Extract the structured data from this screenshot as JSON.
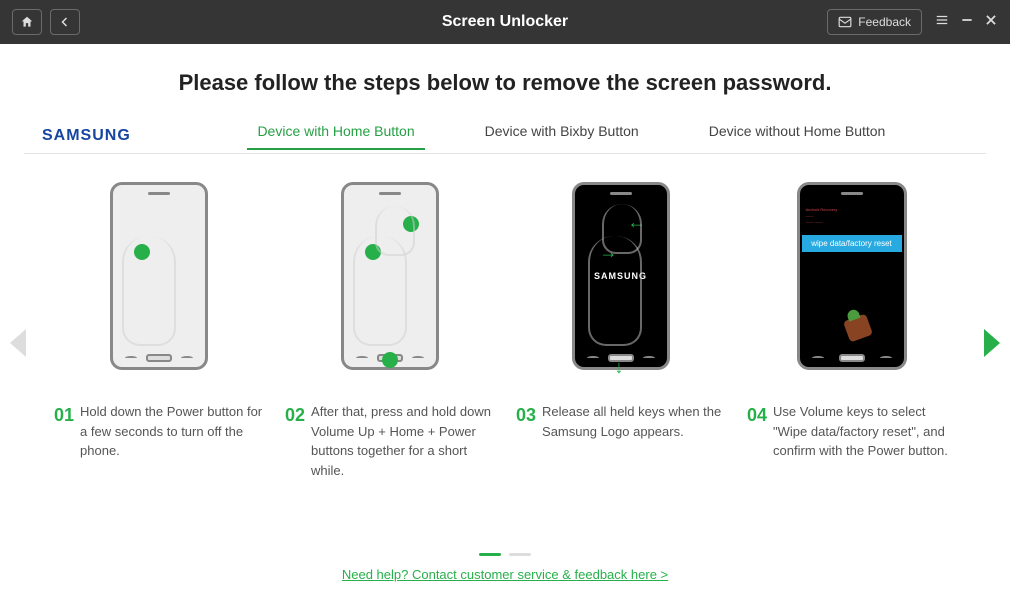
{
  "titlebar": {
    "title": "Screen Unlocker",
    "feedback_label": "Feedback"
  },
  "heading": "Please follow the steps below to remove the screen password.",
  "brand": "SAMSUNG",
  "tabs": [
    {
      "label": "Device with Home Button",
      "active": true
    },
    {
      "label": "Device with Bixby Button",
      "active": false
    },
    {
      "label": "Device without Home Button",
      "active": false
    }
  ],
  "steps": [
    {
      "num": "01",
      "text": "Hold down the Power button for a few seconds to turn off the phone."
    },
    {
      "num": "02",
      "text": "After that, press and hold down Volume Up + Home + Power buttons together for a short while."
    },
    {
      "num": "03",
      "text": "Release all held keys when the Samsung Logo appears."
    },
    {
      "num": "04",
      "text": "Use Volume keys to select \"Wipe data/factory reset\", and confirm with the Power button."
    }
  ],
  "phone3_logo": "SAMSUNG",
  "wipe_label": "wipe data/factory reset",
  "help_link": "Need help? Contact customer service & feedback here >"
}
